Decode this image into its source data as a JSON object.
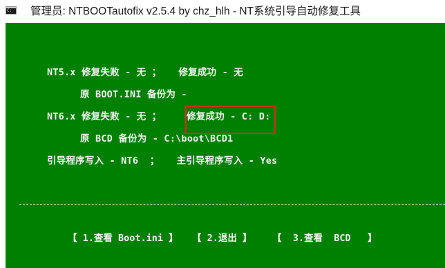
{
  "window": {
    "title": "管理员:  NTBOOTautofix v2.5.4 by chz_hlh - NT系统引导自动修复工具"
  },
  "console": {
    "lines": [
      "NT5.x 修复失败 - 无 ；   修复成功 - 无",
      "原 BOOT.INI 备份为 -",
      "NT6.x 修复失败 - 无 ；",
      "修复成功 - C: D:",
      "原 BCD 备份为 - C:\\boot\\BCD1",
      "引导程序写入 - NT6  ；   主引导程序写入 - Yes"
    ],
    "menu": [
      "【 1.查看 Boot.ini 】",
      "【 2.退出 】",
      "【  3.查看  BCD   】"
    ]
  },
  "colors": {
    "console_background": "#008000",
    "console_text": "#f2f2f2",
    "highlight_border": "#d9281f"
  },
  "icons": {
    "app": "console-app-icon"
  }
}
